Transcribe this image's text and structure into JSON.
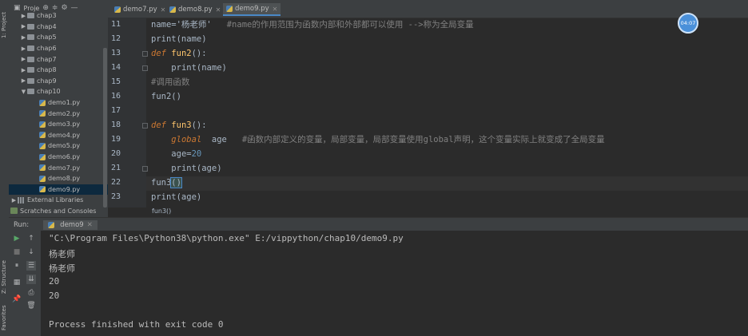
{
  "left_strip": {
    "project_tab": "1: Project",
    "structure_tab": "Z: Structure",
    "favorites_tab": "Favorites"
  },
  "project": {
    "title": "Proje",
    "items": [
      {
        "label": "chap3",
        "kind": "folder"
      },
      {
        "label": "chap4",
        "kind": "folder"
      },
      {
        "label": "chap5",
        "kind": "folder"
      },
      {
        "label": "chap6",
        "kind": "folder"
      },
      {
        "label": "chap7",
        "kind": "folder"
      },
      {
        "label": "chap8",
        "kind": "folder"
      },
      {
        "label": "chap9",
        "kind": "folder"
      },
      {
        "label": "chap10",
        "kind": "folder-open"
      },
      {
        "label": "demo1.py",
        "kind": "file"
      },
      {
        "label": "demo2.py",
        "kind": "file"
      },
      {
        "label": "demo3.py",
        "kind": "file"
      },
      {
        "label": "demo4.py",
        "kind": "file"
      },
      {
        "label": "demo5.py",
        "kind": "file"
      },
      {
        "label": "demo6.py",
        "kind": "file"
      },
      {
        "label": "demo7.py",
        "kind": "file"
      },
      {
        "label": "demo8.py",
        "kind": "file"
      },
      {
        "label": "demo9.py",
        "kind": "file-selected"
      },
      {
        "label": "External Libraries",
        "kind": "lib"
      },
      {
        "label": "Scratches and Consoles",
        "kind": "scratch"
      }
    ]
  },
  "tabs": [
    {
      "label": "demo7.py",
      "active": false
    },
    {
      "label": "demo8.py",
      "active": false
    },
    {
      "label": "demo9.py",
      "active": true
    }
  ],
  "editor": {
    "line_numbers": [
      "11",
      "12",
      "13",
      "14",
      "15",
      "16",
      "17",
      "18",
      "19",
      "20",
      "21",
      "22",
      "23"
    ],
    "lines": {
      "l11_code": "name='杨老师'",
      "l11_comment": "#name的作用范围为函数内部和外部都可以使用 -->称为全局变量",
      "l12": "print(name)",
      "l13_kw": "def",
      "l13_fn": "fun2",
      "l13_rest": "():",
      "l14": "print(name)",
      "l15": "#调用函数",
      "l16": "fun2()",
      "l18_kw": "def",
      "l18_fn": "fun3",
      "l18_rest": "():",
      "l19_kw": "global",
      "l19_var": "age",
      "l19_comment": "#函数内部定义的变量，局部变量，局部变量使用global声明，这个变量实际上就变成了全局变量",
      "l20_var": "age=",
      "l20_num": "20",
      "l21": "print(age)",
      "l22_name": "fun3",
      "l22_paren": "()",
      "l23": "print(age)"
    },
    "breadcrumb": "fun3()"
  },
  "avatar": {
    "text": "04:07"
  },
  "run": {
    "label": "Run:",
    "tab": "demo9",
    "output": [
      "\"C:\\Program Files\\Python38\\python.exe\" E:/vippython/chap10/demo9.py",
      "杨老师",
      "杨老师",
      "20",
      "20",
      "",
      "Process finished with exit code 0"
    ]
  },
  "colors": {
    "background": "#2b2b2b",
    "panel": "#3c3f41",
    "keyword": "#cc7832",
    "function": "#ffc66d",
    "string": "#6a8759",
    "number": "#6897bb",
    "comment": "#808080"
  }
}
